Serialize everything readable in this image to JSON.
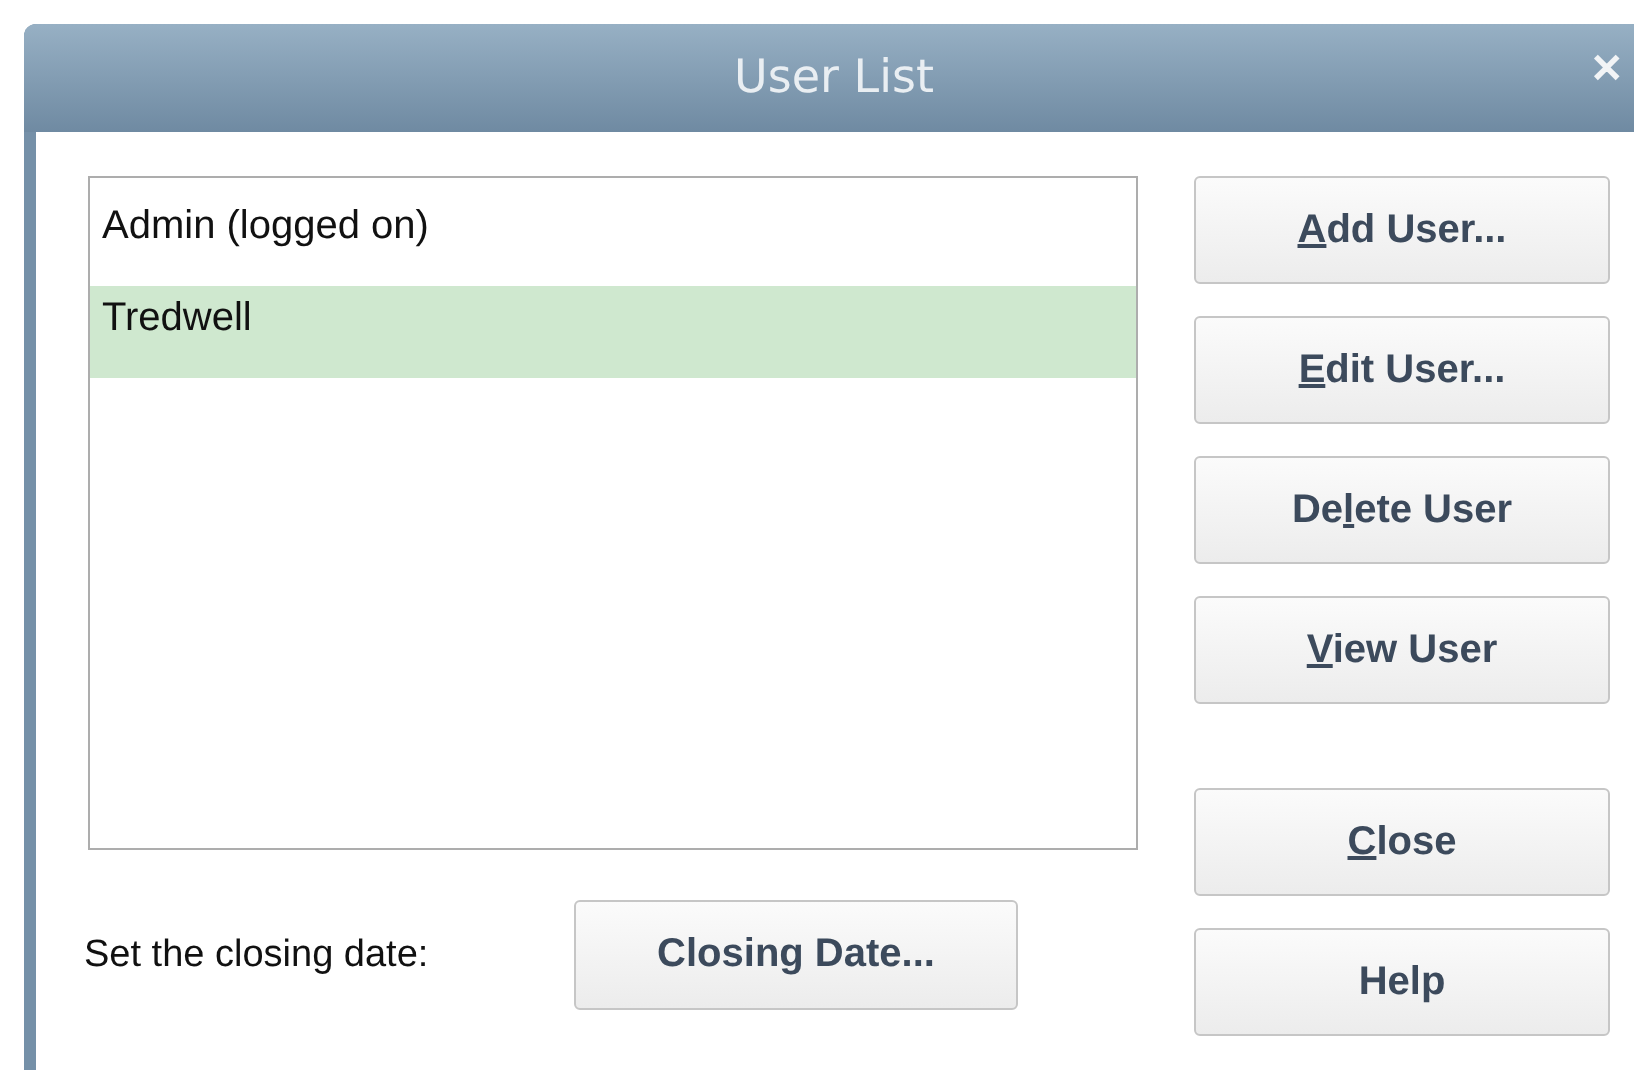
{
  "window": {
    "title": "User List",
    "close_glyph": "✕"
  },
  "users": [
    {
      "name": "Admin (logged on)",
      "selected": false
    },
    {
      "name": "Tredwell",
      "selected": true
    }
  ],
  "buttons": [
    {
      "key": "A",
      "after": "dd User..."
    },
    {
      "key": "E",
      "after": "dit User..."
    },
    {
      "before": "De",
      "key": "l",
      "after": "ete User"
    },
    {
      "key": "V",
      "after": "iew User"
    },
    {
      "key": "C",
      "after": "lose"
    },
    {
      "before": "Help"
    }
  ],
  "closing": {
    "label": "Set the closing date:",
    "button": "Closing Date..."
  }
}
